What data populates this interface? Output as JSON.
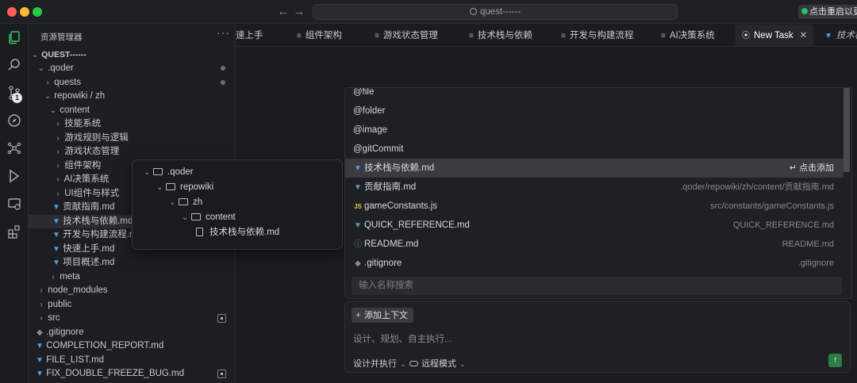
{
  "window": {
    "search_text": "quest------",
    "restart_label": "点击重启以更新"
  },
  "sidebar": {
    "header": "资源管理器",
    "more": "···",
    "root": "QUEST------",
    "items": [
      {
        "label": ".qoder"
      },
      {
        "label": "quests"
      },
      {
        "label": "repowiki / zh"
      },
      {
        "label": "content"
      },
      {
        "label": "技能系统"
      },
      {
        "label": "游戏规则与逻辑"
      },
      {
        "label": "游戏状态管理"
      },
      {
        "label": "组件架构"
      },
      {
        "label": "AI决策系统"
      },
      {
        "label": "UI组件与样式"
      },
      {
        "label": "贡献指南.md"
      },
      {
        "label": "技术栈与依赖.md"
      },
      {
        "label": "开发与构建流程.md"
      },
      {
        "label": "快速上手.md"
      },
      {
        "label": "项目概述.md"
      },
      {
        "label": "meta"
      },
      {
        "label": "node_modules"
      },
      {
        "label": "public"
      },
      {
        "label": "src"
      },
      {
        "label": ".gitignore"
      },
      {
        "label": "COMPLETION_REPORT.md"
      },
      {
        "label": "FILE_LIST.md"
      },
      {
        "label": "FIX_DOUBLE_FREEZE_BUG.md"
      }
    ],
    "scm_badge": "1"
  },
  "tabs": [
    {
      "label": "速上手"
    },
    {
      "label": "组件架构"
    },
    {
      "label": "游戏状态管理"
    },
    {
      "label": "技术栈与依赖"
    },
    {
      "label": "开发与构建流程"
    },
    {
      "label": "AI决策系统"
    },
    {
      "label": "New Task"
    },
    {
      "label": "技术栈"
    }
  ],
  "popup_tree": {
    "rows": [
      {
        "label": ".qoder"
      },
      {
        "label": "repowiki"
      },
      {
        "label": "zh"
      },
      {
        "label": "content"
      },
      {
        "label": "技术栈与依赖.md"
      }
    ]
  },
  "mention": {
    "items": [
      {
        "label": "@file"
      },
      {
        "label": "@folder"
      },
      {
        "label": "@image"
      },
      {
        "label": "@gitCommit"
      },
      {
        "label": "技术栈与依赖.md",
        "action": "↵ 点击添加"
      },
      {
        "label": "贡献指南.md",
        "path": ".qoder/repowiki/zh/content/贡献指南.md"
      },
      {
        "label": "gameConstants.js",
        "path": "src/constants/gameConstants.js"
      },
      {
        "label": "QUICK_REFERENCE.md",
        "path": "QUICK_REFERENCE.md"
      },
      {
        "label": "README.md",
        "path": "README.md"
      },
      {
        "label": ".gitignore",
        "path": ".gitignore"
      }
    ],
    "search_placeholder": "输入名称搜索"
  },
  "chat": {
    "add_context": "添加上下文",
    "placeholder": "设计、规划、自主执行...",
    "mode": "设计并执行",
    "env": "远程模式"
  },
  "colors": {
    "accent_green": "#2fbe62",
    "md_icon_blue": "#4a9fe0",
    "js_icon_yellow": "#e6c84c"
  }
}
